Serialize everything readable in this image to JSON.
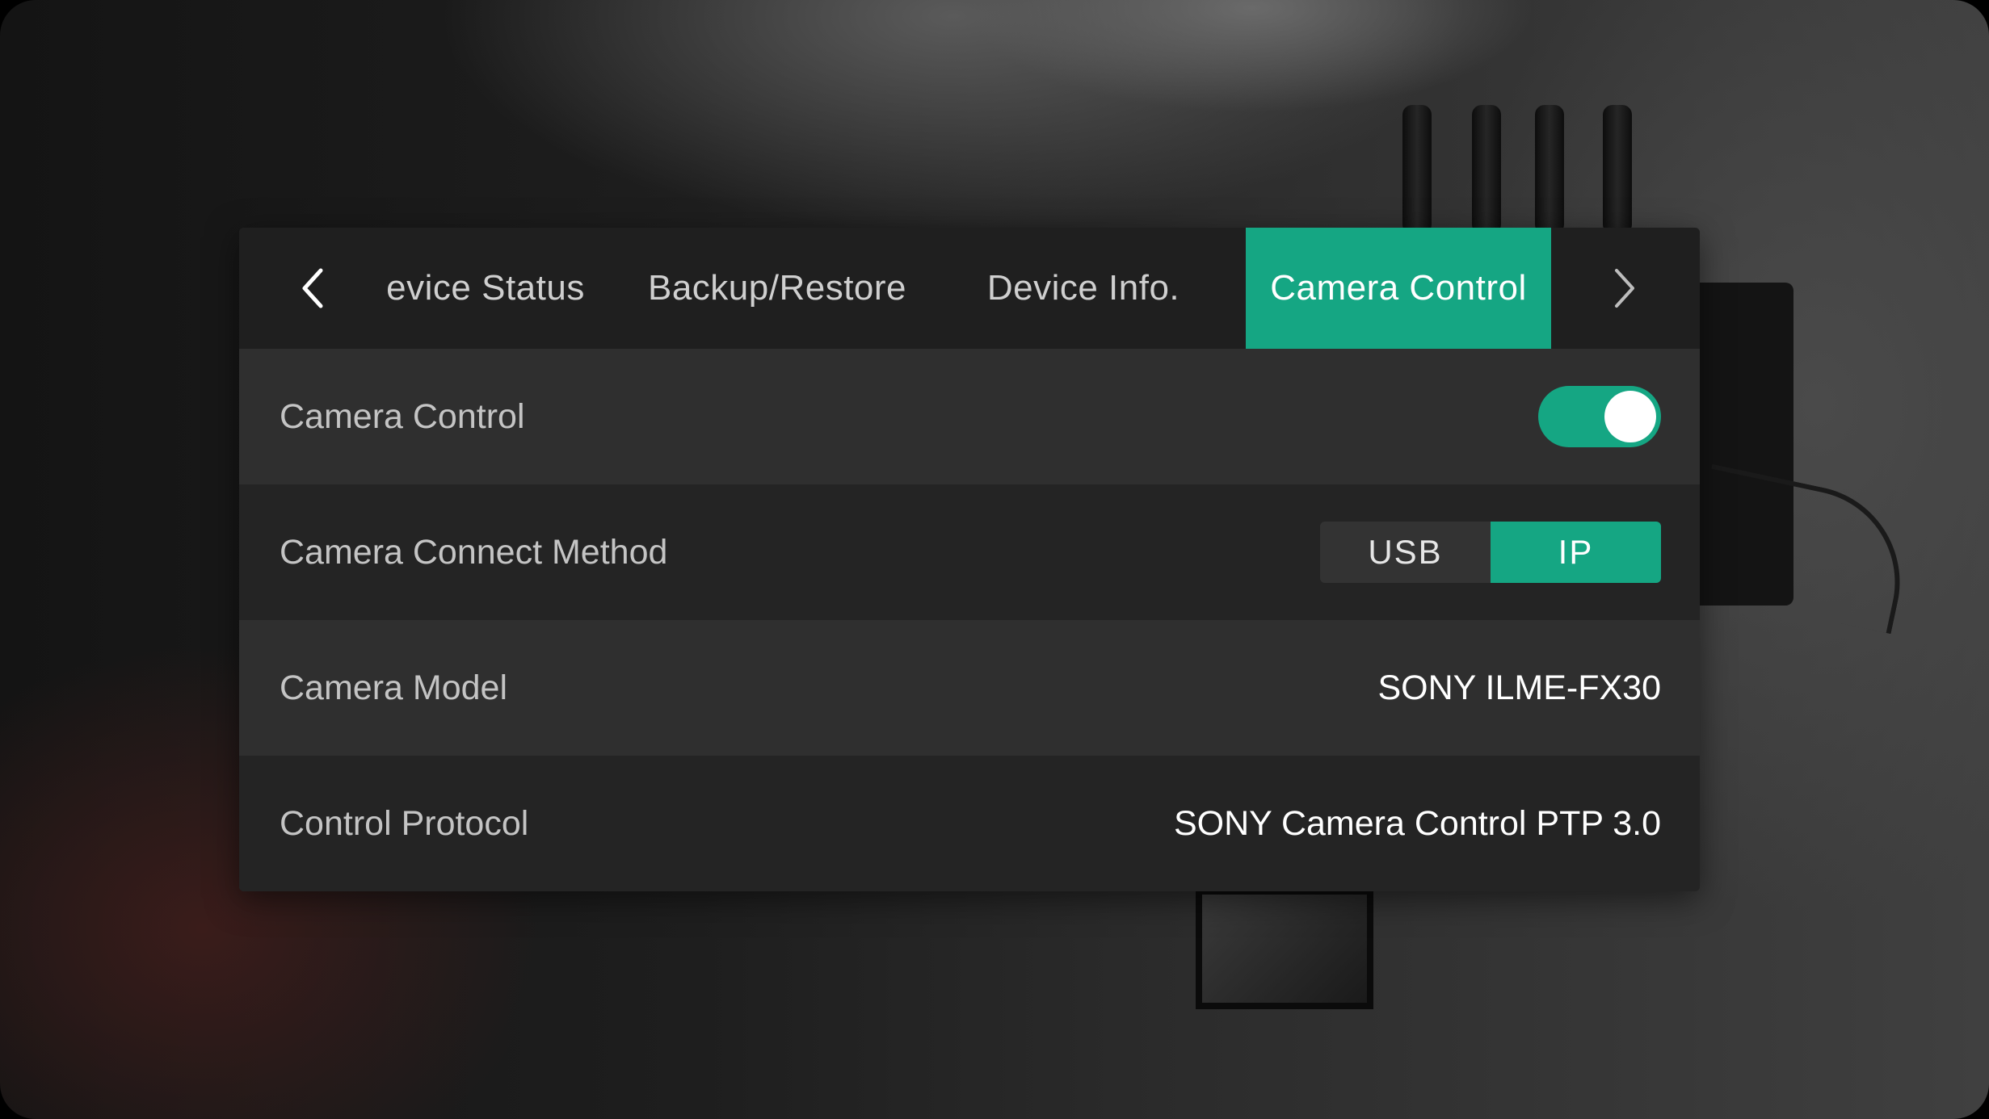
{
  "tabs": {
    "items": [
      {
        "label": "evice Status"
      },
      {
        "label": "Backup/Restore"
      },
      {
        "label": "Device Info."
      },
      {
        "label": "Camera Control"
      }
    ],
    "active_index": 3,
    "prev_icon": "chevron-left-icon",
    "next_icon": "chevron-right-icon"
  },
  "settings": {
    "camera_control": {
      "label": "Camera Control",
      "enabled": true
    },
    "connect_method": {
      "label": "Camera Connect Method",
      "options": [
        "USB",
        "IP"
      ],
      "selected": "IP"
    },
    "camera_model": {
      "label": "Camera Model",
      "value": "SONY ILME-FX30"
    },
    "control_protocol": {
      "label": "Control Protocol",
      "value": "SONY Camera Control PTP 3.0"
    }
  },
  "colors": {
    "accent": "#15a683",
    "tabbar_bg": "#1f1f1f",
    "row_light": "#2f2f2f",
    "row_dark": "#242424"
  }
}
